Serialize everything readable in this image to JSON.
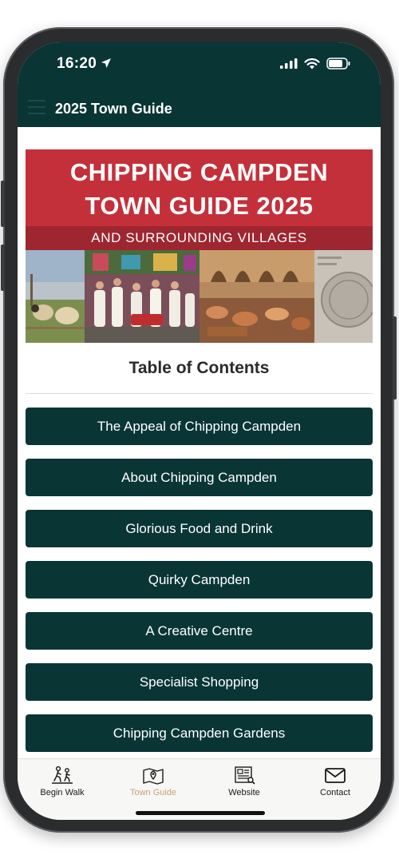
{
  "status_bar": {
    "time": "16:20"
  },
  "header": {
    "title": "2025 Town Guide"
  },
  "cover": {
    "title_line1": "CHIPPING CAMPDEN",
    "title_line2": "TOWN GUIDE 2025",
    "subtitle": "AND SURROUNDING VILLAGES",
    "colors": {
      "red": "#c4303a",
      "dark_red": "#9e2630"
    }
  },
  "toc": {
    "heading": "Table of Contents",
    "items": [
      {
        "label": "The Appeal of Chipping Campden"
      },
      {
        "label": "About Chipping Campden"
      },
      {
        "label": "Glorious Food and Drink"
      },
      {
        "label": "Quirky Campden"
      },
      {
        "label": "A Creative Centre"
      },
      {
        "label": "Specialist Shopping"
      },
      {
        "label": "Chipping Campden Gardens"
      }
    ]
  },
  "tabs": [
    {
      "label": "Begin Walk",
      "icon": "walker-icon",
      "active": false
    },
    {
      "label": "Town Guide",
      "icon": "map-pin-icon",
      "active": true
    },
    {
      "label": "Website",
      "icon": "newspaper-icon",
      "active": false
    },
    {
      "label": "Contact",
      "icon": "envelope-icon",
      "active": false
    }
  ],
  "colors": {
    "primary": "#093535",
    "accent_tab": "#c8a27a",
    "tab_bar_bg": "#f7f7f5"
  }
}
